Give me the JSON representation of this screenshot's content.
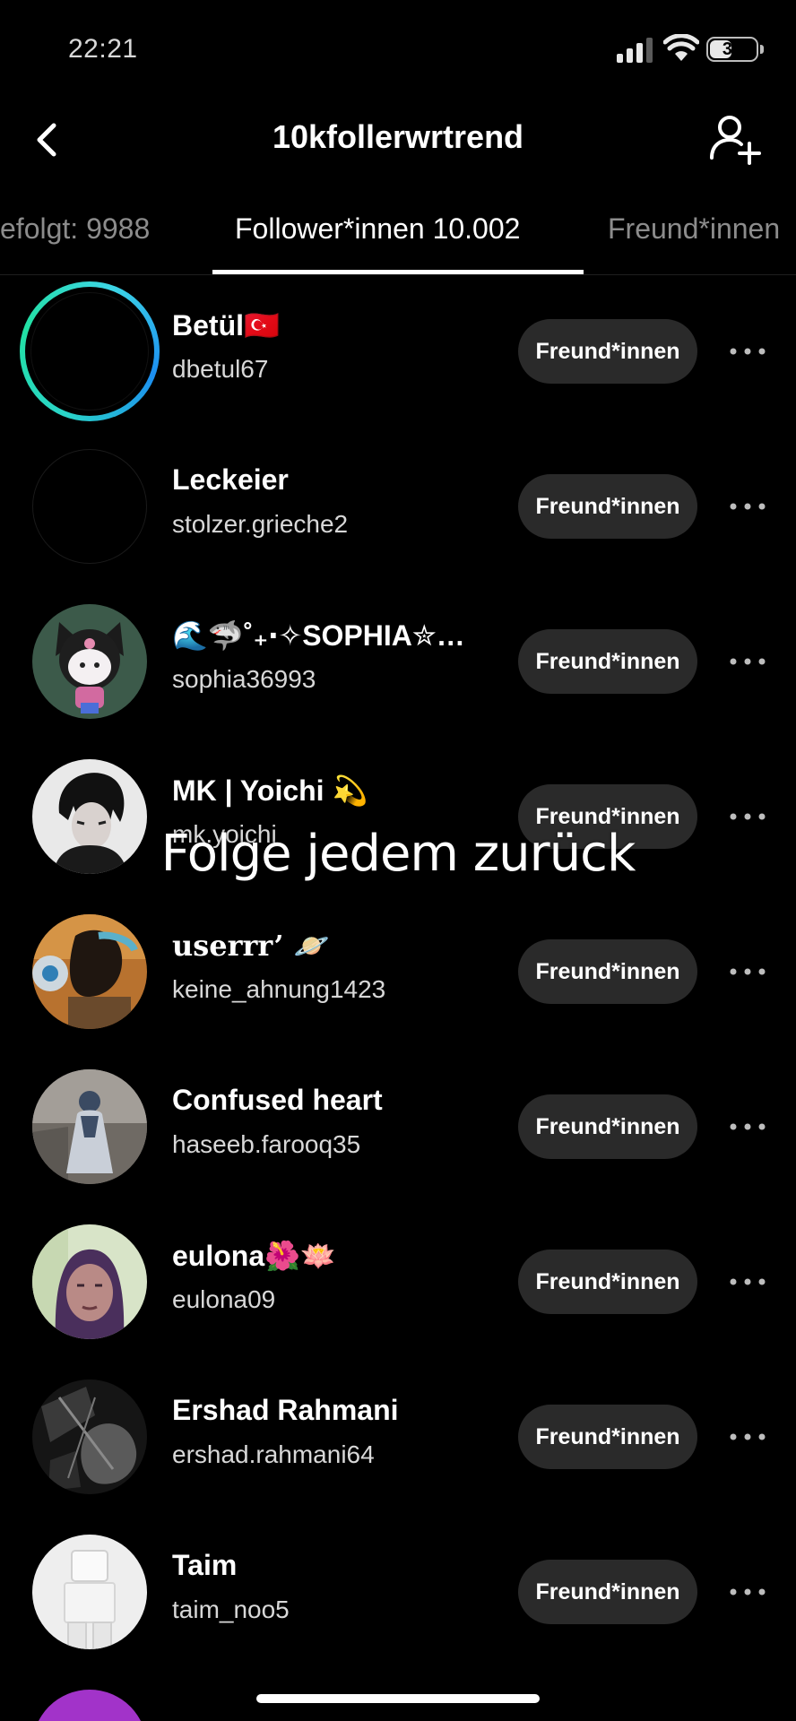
{
  "status_bar": {
    "time": "22:21",
    "battery": "37"
  },
  "header": {
    "title": "10kfollerwrtrend"
  },
  "tabs": [
    {
      "label": "efolgt: 9988",
      "active": false
    },
    {
      "label": "Follower*innen 10.002",
      "active": true
    },
    {
      "label": "Freund*innen",
      "active": false
    }
  ],
  "followers": [
    {
      "name": "Betül🇹🇷",
      "handle": "dbetul67",
      "button": "Freund*innen"
    },
    {
      "name": "Leckeier",
      "handle": "stolzer.grieche2",
      "button": "Freund*innen"
    },
    {
      "name": "🌊🦈˚₊‧✧SOPHIA✮…",
      "handle": "sophia36993",
      "button": "Freund*innen"
    },
    {
      "name": "MK | Yoichi 💫",
      "handle": "mk.yoichi",
      "button": "Freund*innen"
    },
    {
      "name": "userrr’ 🪐",
      "handle": "keine_ahnung1423",
      "button": "Freund*innen"
    },
    {
      "name": "Confused heart",
      "handle": "haseeb.farooq35",
      "button": "Freund*innen"
    },
    {
      "name": "eulona🌺🪷",
      "handle": "eulona09",
      "button": "Freund*innen"
    },
    {
      "name": "Ershad Rahmani",
      "handle": "ershad.rahmani64",
      "button": "Freund*innen"
    },
    {
      "name": "Taim",
      "handle": "taim_noo5",
      "button": "Freund*innen"
    }
  ],
  "overlay_text": "Folge jedem zurück",
  "colors": {
    "background": "#000000",
    "button": "#2a2a2a",
    "story_ring": "#22e0a3"
  }
}
